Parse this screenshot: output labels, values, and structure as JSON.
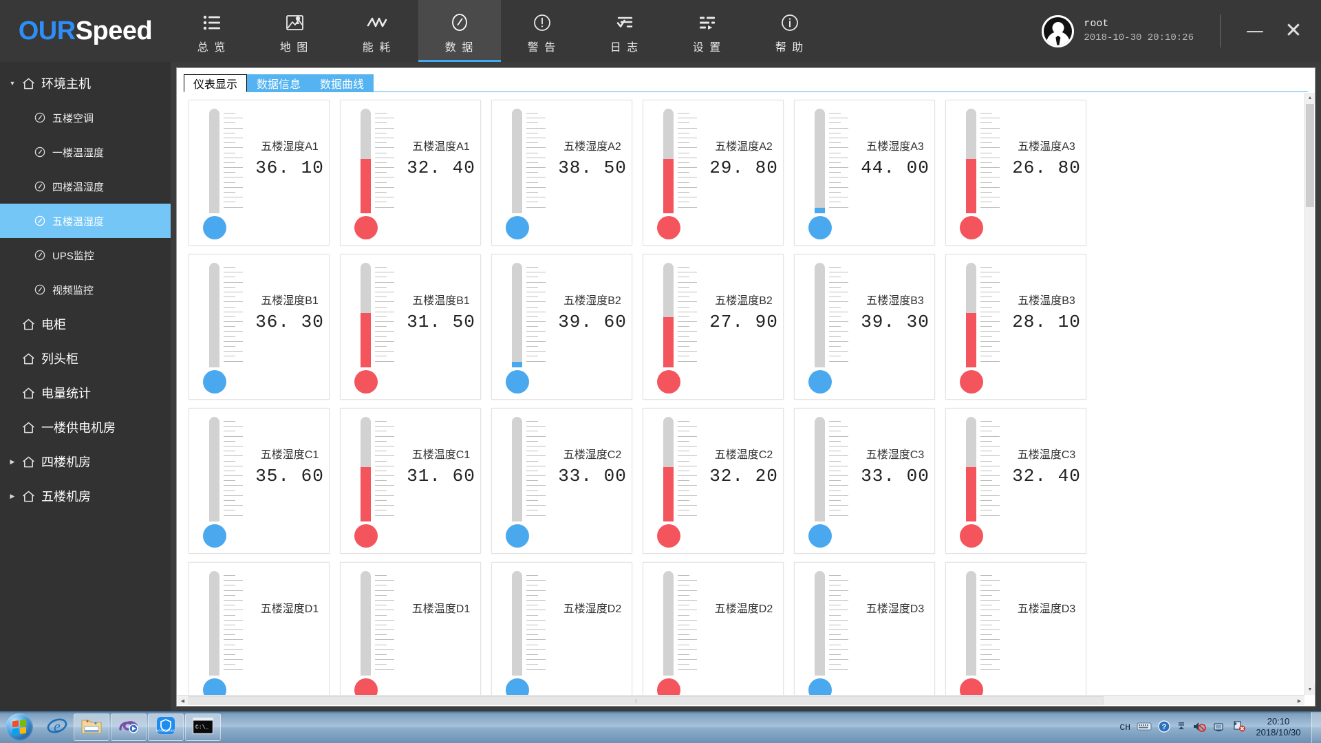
{
  "app": {
    "brand_our": "OUR",
    "brand_speed": "Speed",
    "accent": "#2e8ef7",
    "topbar_bg": "#383838",
    "selected_bg": "#74c6f7"
  },
  "nav": {
    "items": [
      {
        "label": "总 览",
        "icon": "list-icon",
        "active": false
      },
      {
        "label": "地 图",
        "icon": "map-icon",
        "active": false
      },
      {
        "label": "能 耗",
        "icon": "wave-icon",
        "active": false
      },
      {
        "label": "数 据",
        "icon": "gauge-icon",
        "active": true
      },
      {
        "label": "警 告",
        "icon": "alert-icon",
        "active": false
      },
      {
        "label": "日 志",
        "icon": "log-icon",
        "active": false
      },
      {
        "label": "设 置",
        "icon": "settings-icon",
        "active": false
      },
      {
        "label": "帮 助",
        "icon": "info-icon",
        "active": false
      }
    ]
  },
  "user": {
    "name": "root",
    "datetime": "2018-10-30 20:10:26",
    "minimize_label": "—",
    "close_label": "✕"
  },
  "sidebar": {
    "items": [
      {
        "label": "环境主机",
        "level": "root",
        "arrow": "▼",
        "icon": "home-icon",
        "selected": false
      },
      {
        "label": "五楼空调",
        "level": "child",
        "arrow": "",
        "icon": "gauge-icon",
        "selected": false
      },
      {
        "label": "一楼温湿度",
        "level": "child",
        "arrow": "",
        "icon": "gauge-icon",
        "selected": false
      },
      {
        "label": "四楼温湿度",
        "level": "child",
        "arrow": "",
        "icon": "gauge-icon",
        "selected": false
      },
      {
        "label": "五楼温湿度",
        "level": "child",
        "arrow": "",
        "icon": "gauge-icon",
        "selected": true
      },
      {
        "label": "UPS监控",
        "level": "child",
        "arrow": "",
        "icon": "gauge-icon",
        "selected": false
      },
      {
        "label": "视频监控",
        "level": "child",
        "arrow": "",
        "icon": "gauge-icon",
        "selected": false
      },
      {
        "label": "电柜",
        "level": "root",
        "arrow": "",
        "icon": "home-icon",
        "selected": false
      },
      {
        "label": "列头柜",
        "level": "root",
        "arrow": "",
        "icon": "home-icon",
        "selected": false
      },
      {
        "label": "电量统计",
        "level": "root",
        "arrow": "",
        "icon": "home-icon",
        "selected": false
      },
      {
        "label": "一楼供电机房",
        "level": "root",
        "arrow": "",
        "icon": "home-icon",
        "selected": false
      },
      {
        "label": "四楼机房",
        "level": "root",
        "arrow": "▶",
        "icon": "home-icon",
        "selected": false
      },
      {
        "label": "五楼机房",
        "level": "root",
        "arrow": "▶",
        "icon": "home-icon",
        "selected": false
      }
    ]
  },
  "tabs": [
    {
      "label": "仪表显示",
      "active": true
    },
    {
      "label": "数据信息",
      "active": false
    },
    {
      "label": "数据曲线",
      "active": false
    }
  ],
  "gauges": [
    {
      "name": "五楼湿度A1",
      "value": "36. 10",
      "kind": "humidity",
      "color": "#4aa8ef",
      "fill_pct": 0
    },
    {
      "name": "五楼温度A1",
      "value": "32. 40",
      "kind": "temperature",
      "color": "#f4545c",
      "fill_pct": 52
    },
    {
      "name": "五楼湿度A2",
      "value": "38. 50",
      "kind": "humidity",
      "color": "#4aa8ef",
      "fill_pct": 0
    },
    {
      "name": "五楼温度A2",
      "value": "29. 80",
      "kind": "temperature",
      "color": "#f4545c",
      "fill_pct": 52
    },
    {
      "name": "五楼湿度A3",
      "value": "44. 00",
      "kind": "humidity",
      "color": "#4aa8ef",
      "fill_pct": 5
    },
    {
      "name": "五楼温度A3",
      "value": "26. 80",
      "kind": "temperature",
      "color": "#f4545c",
      "fill_pct": 52
    },
    {
      "name": "五楼湿度B1",
      "value": "36. 30",
      "kind": "humidity",
      "color": "#4aa8ef",
      "fill_pct": 0
    },
    {
      "name": "五楼温度B1",
      "value": "31. 50",
      "kind": "temperature",
      "color": "#f4545c",
      "fill_pct": 52
    },
    {
      "name": "五楼湿度B2",
      "value": "39. 60",
      "kind": "humidity",
      "color": "#4aa8ef",
      "fill_pct": 5
    },
    {
      "name": "五楼温度B2",
      "value": "27. 90",
      "kind": "temperature",
      "color": "#f4545c",
      "fill_pct": 48
    },
    {
      "name": "五楼湿度B3",
      "value": "39. 30",
      "kind": "humidity",
      "color": "#4aa8ef",
      "fill_pct": 0
    },
    {
      "name": "五楼温度B3",
      "value": "28. 10",
      "kind": "temperature",
      "color": "#f4545c",
      "fill_pct": 52
    },
    {
      "name": "五楼湿度C1",
      "value": "35. 60",
      "kind": "humidity",
      "color": "#4aa8ef",
      "fill_pct": 0
    },
    {
      "name": "五楼温度C1",
      "value": "31. 60",
      "kind": "temperature",
      "color": "#f4545c",
      "fill_pct": 52
    },
    {
      "name": "五楼湿度C2",
      "value": "33. 00",
      "kind": "humidity",
      "color": "#4aa8ef",
      "fill_pct": 0
    },
    {
      "name": "五楼温度C2",
      "value": "32. 20",
      "kind": "temperature",
      "color": "#f4545c",
      "fill_pct": 52
    },
    {
      "name": "五楼湿度C3",
      "value": "33. 00",
      "kind": "humidity",
      "color": "#4aa8ef",
      "fill_pct": 0
    },
    {
      "name": "五楼温度C3",
      "value": "32. 40",
      "kind": "temperature",
      "color": "#f4545c",
      "fill_pct": 52
    },
    {
      "name": "五楼湿度D1",
      "value": "",
      "kind": "humidity",
      "color": "#4aa8ef",
      "fill_pct": 0,
      "clipped": true
    },
    {
      "name": "五楼温度D1",
      "value": "",
      "kind": "temperature",
      "color": "#f4545c",
      "fill_pct": 0,
      "clipped": true
    },
    {
      "name": "五楼湿度D2",
      "value": "",
      "kind": "humidity",
      "color": "#4aa8ef",
      "fill_pct": 0,
      "clipped": true
    },
    {
      "name": "五楼温度D2",
      "value": "",
      "kind": "temperature",
      "color": "#f4545c",
      "fill_pct": 0,
      "clipped": true
    },
    {
      "name": "五楼湿度D3",
      "value": "",
      "kind": "humidity",
      "color": "#4aa8ef",
      "fill_pct": 0,
      "clipped": true
    },
    {
      "name": "五楼温度D3",
      "value": "",
      "kind": "temperature",
      "color": "#f4545c",
      "fill_pct": 0,
      "clipped": true
    }
  ],
  "taskbar": {
    "ime_label": "CH",
    "clock_time": "20:10",
    "clock_date": "2018/10/30",
    "buttons": [
      {
        "name": "start-orb"
      },
      {
        "name": "internet-explorer-icon"
      },
      {
        "name": "file-explorer-icon"
      },
      {
        "name": "media-player-icon"
      },
      {
        "name": "monitoring-shield-icon"
      },
      {
        "name": "command-prompt-icon"
      }
    ],
    "tray": [
      {
        "name": "keyboard-icon"
      },
      {
        "name": "help-icon"
      },
      {
        "name": "chevron-up-icon"
      },
      {
        "name": "volume-muted-icon"
      },
      {
        "name": "network-icon"
      },
      {
        "name": "action-center-icon"
      }
    ]
  }
}
